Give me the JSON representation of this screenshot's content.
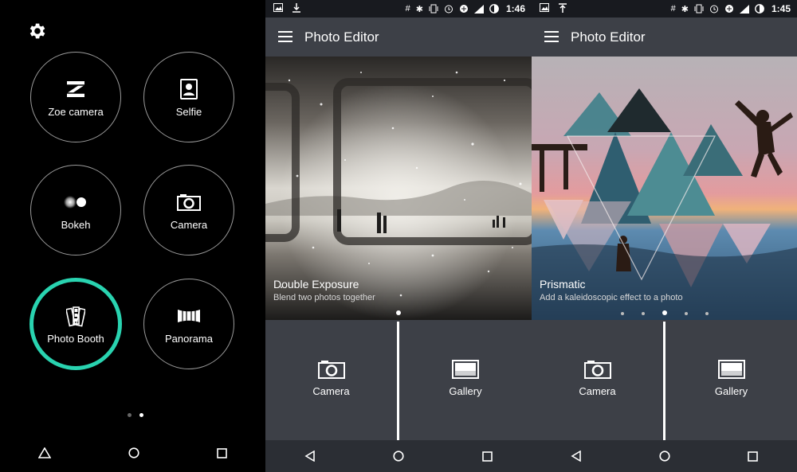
{
  "camera_modes": {
    "modes": [
      {
        "label": "Zoe camera",
        "icon": "zoe-icon"
      },
      {
        "label": "Selfie",
        "icon": "selfie-icon"
      },
      {
        "label": "Bokeh",
        "icon": "bokeh-icon"
      },
      {
        "label": "Camera",
        "icon": "camera-icon"
      },
      {
        "label": "Photo Booth",
        "icon": "photo-booth-icon",
        "selected": true
      },
      {
        "label": "Panorama",
        "icon": "panorama-icon"
      }
    ],
    "page_count": 2,
    "current_page": 2,
    "accent": "#29d3b0"
  },
  "editor_left": {
    "status_time": "1:46",
    "app_title": "Photo Editor",
    "feature_title": "Double Exposure",
    "feature_subtitle": "Blend two photos together",
    "tiles": [
      {
        "label": "Camera",
        "icon": "camera-icon"
      },
      {
        "label": "Gallery",
        "icon": "gallery-icon"
      }
    ]
  },
  "editor_right": {
    "status_time": "1:45",
    "app_title": "Photo Editor",
    "feature_title": "Prismatic",
    "feature_subtitle": "Add a kaleidoscopic effect to a photo",
    "tiles": [
      {
        "label": "Camera",
        "icon": "camera-icon"
      },
      {
        "label": "Gallery",
        "icon": "gallery-icon"
      }
    ]
  },
  "colors": {
    "appbar": "#3d4047",
    "status_bar": "#181a1f"
  }
}
